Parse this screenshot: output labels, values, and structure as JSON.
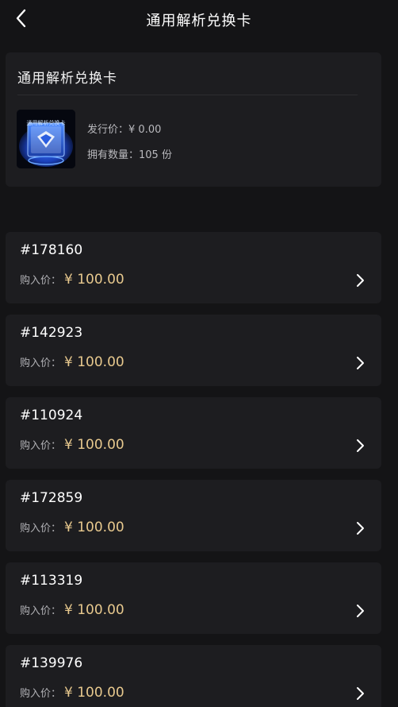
{
  "header": {
    "title": "通用解析兑换卡"
  },
  "summary": {
    "title": "通用解析兑换卡",
    "thumbnail_caption": "通用解析兑换卡",
    "issue_price_label": "发行价：",
    "issue_price_value": "¥ 0.00",
    "quantity_label": "拥有数量：",
    "quantity_value": "105 份"
  },
  "items": [
    {
      "id": "#178160",
      "price_label": "购入价：",
      "price_value": "¥ 100.00"
    },
    {
      "id": "#142923",
      "price_label": "购入价：",
      "price_value": "¥ 100.00"
    },
    {
      "id": "#110924",
      "price_label": "购入价：",
      "price_value": "¥ 100.00"
    },
    {
      "id": "#172859",
      "price_label": "购入价：",
      "price_value": "¥ 100.00"
    },
    {
      "id": "#113319",
      "price_label": "购入价：",
      "price_value": "¥ 100.00"
    },
    {
      "id": "#139976",
      "price_label": "购入价：",
      "price_value": "¥ 100.00"
    }
  ],
  "icons": {
    "back": "chevron-left-icon",
    "row_arrow": "chevron-right-icon"
  },
  "colors": {
    "background": "#141416",
    "card": "#1d1d20",
    "price_accent": "#e8c98e",
    "text_primary": "#ffffff",
    "text_secondary": "#b0b0b4"
  }
}
